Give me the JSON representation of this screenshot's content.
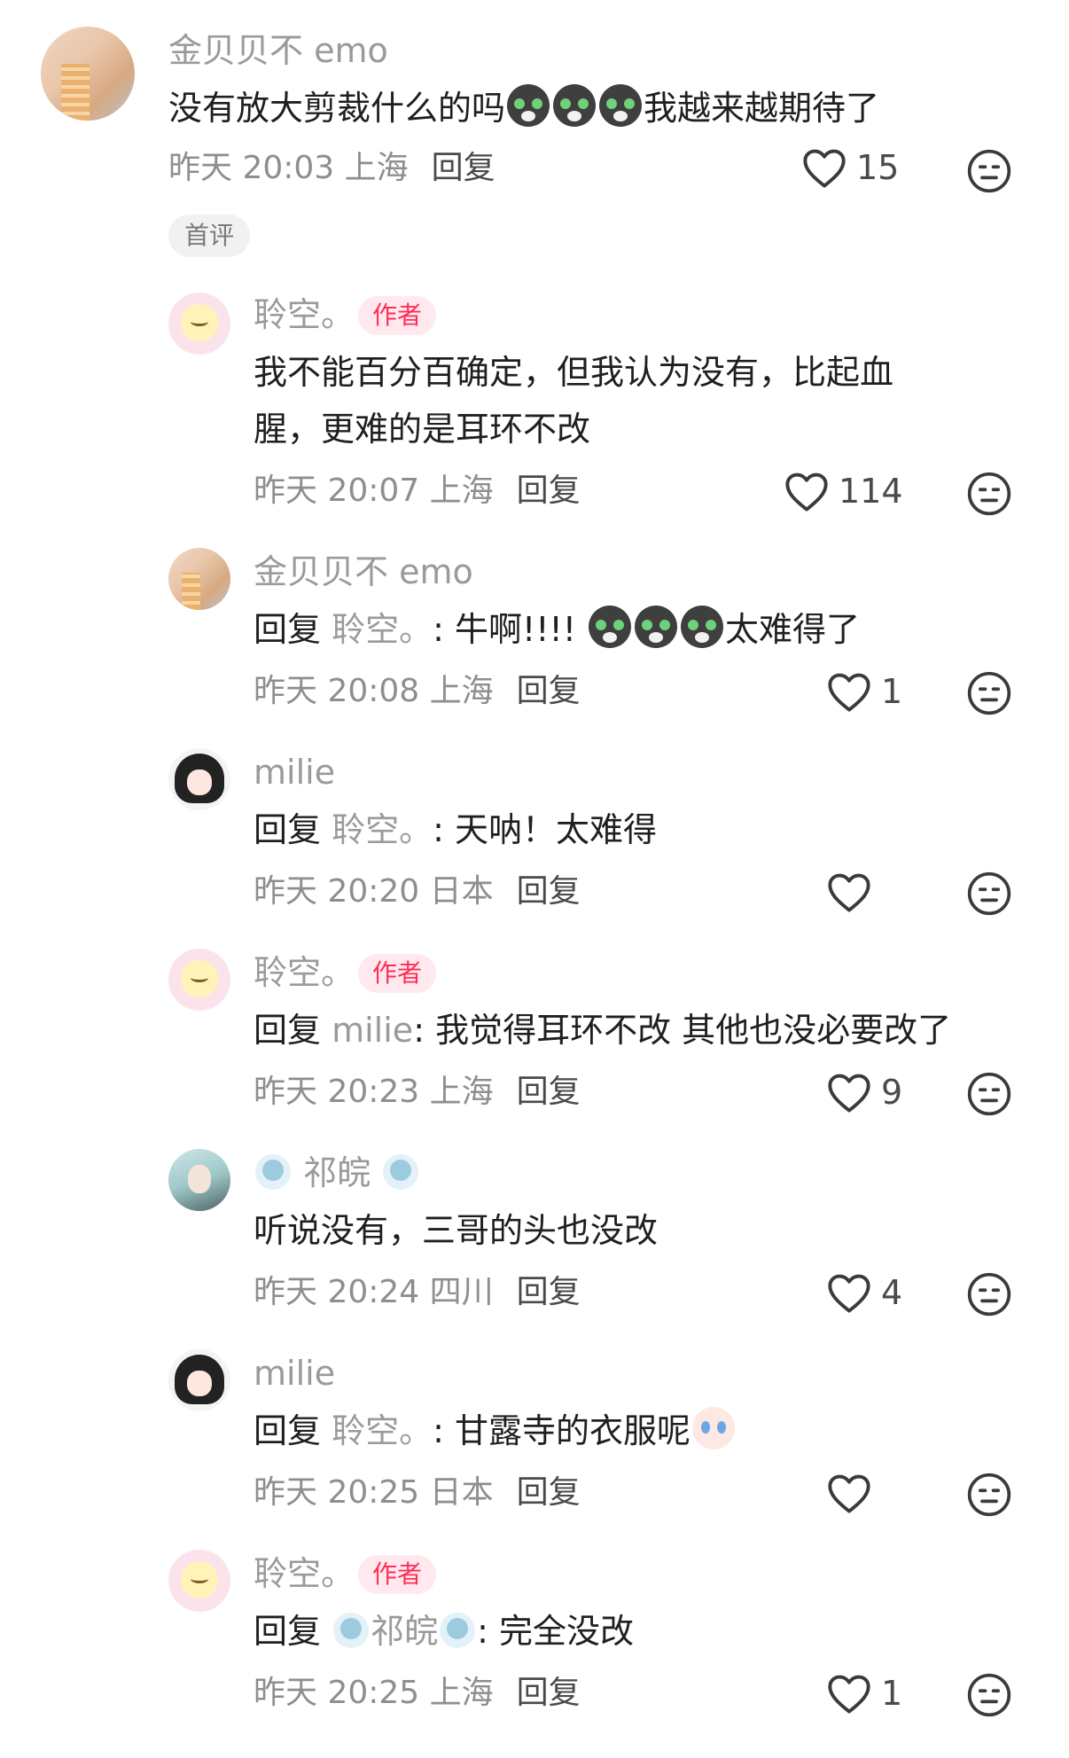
{
  "comments": [
    {
      "username": "金贝贝不 emo",
      "text_prefix": "没有放大剪裁什么的吗",
      "text_suffix": "我越来越期待了",
      "time": "昨天 20:03",
      "location": "上海",
      "reply_label": "回复",
      "likes": "15",
      "badge": "首评",
      "avatar_icon": "building-avatar",
      "inline_emoji": [
        "cat-emoji",
        "cat-emoji",
        "cat-emoji"
      ]
    },
    {
      "username": "聆空。",
      "author_badge": "作者",
      "text_line1": "我不能百分百确定，但我认为没有，比起血",
      "text_line2": "腥，更难的是耳环不改",
      "time": "昨天 20:07",
      "location": "上海",
      "reply_label": "回复",
      "likes": "114",
      "avatar_icon": "chick-avatar"
    },
    {
      "username": "金贝贝不 emo",
      "reply_prefix": "回复",
      "reply_to": "聆空。",
      "text_prefix": ": 牛啊!!!!",
      "text_suffix": "太难得了",
      "time": "昨天 20:08",
      "location": "上海",
      "reply_label": "回复",
      "likes": "1",
      "avatar_icon": "building-avatar",
      "inline_emoji": [
        "cat-emoji",
        "cat-emoji",
        "cat-emoji"
      ]
    },
    {
      "username": "milie",
      "reply_prefix": "回复",
      "reply_to": "聆空。",
      "text": ": 天呐！太难得",
      "time": "昨天 20:20",
      "location": "日本",
      "reply_label": "回复",
      "likes": "",
      "avatar_icon": "girl-avatar"
    },
    {
      "username": "聆空。",
      "author_badge": "作者",
      "reply_prefix": "回复",
      "reply_to": "milie",
      "text": ": 我觉得耳环不改 其他也没必要改了",
      "time": "昨天 20:23",
      "location": "上海",
      "reply_label": "回复",
      "likes": "9",
      "avatar_icon": "chick-avatar"
    },
    {
      "username": "祁皖",
      "text": "听说没有，三哥的头也没改",
      "time": "昨天 20:24",
      "location": "四川",
      "reply_label": "回复",
      "likes": "4",
      "avatar_icon": "anime-girl-avatar",
      "name_emoji": "fan-emoji"
    },
    {
      "username": "milie",
      "reply_prefix": "回复",
      "reply_to": "聆空。",
      "text": ": 甘露寺的衣服呢",
      "time": "昨天 20:25",
      "location": "日本",
      "reply_label": "回复",
      "likes": "",
      "avatar_icon": "girl-avatar",
      "inline_emoji": [
        "crying-cat-emoji"
      ]
    },
    {
      "username": "聆空。",
      "author_badge": "作者",
      "reply_prefix": "回复",
      "reply_to": "祁皖",
      "text": ": 完全没改",
      "time": "昨天 20:25",
      "location": "上海",
      "reply_label": "回复",
      "likes": "1",
      "avatar_icon": "chick-avatar"
    }
  ],
  "icons": {
    "like": "heart-outline-icon",
    "dislike": "meh-face-icon"
  },
  "colors": {
    "username": "#9a9a9a",
    "text": "#1f1f1f",
    "meta": "#8e8e8e",
    "author_badge_bg": "#ffe9ee",
    "author_badge_text": "#ff2d55"
  }
}
